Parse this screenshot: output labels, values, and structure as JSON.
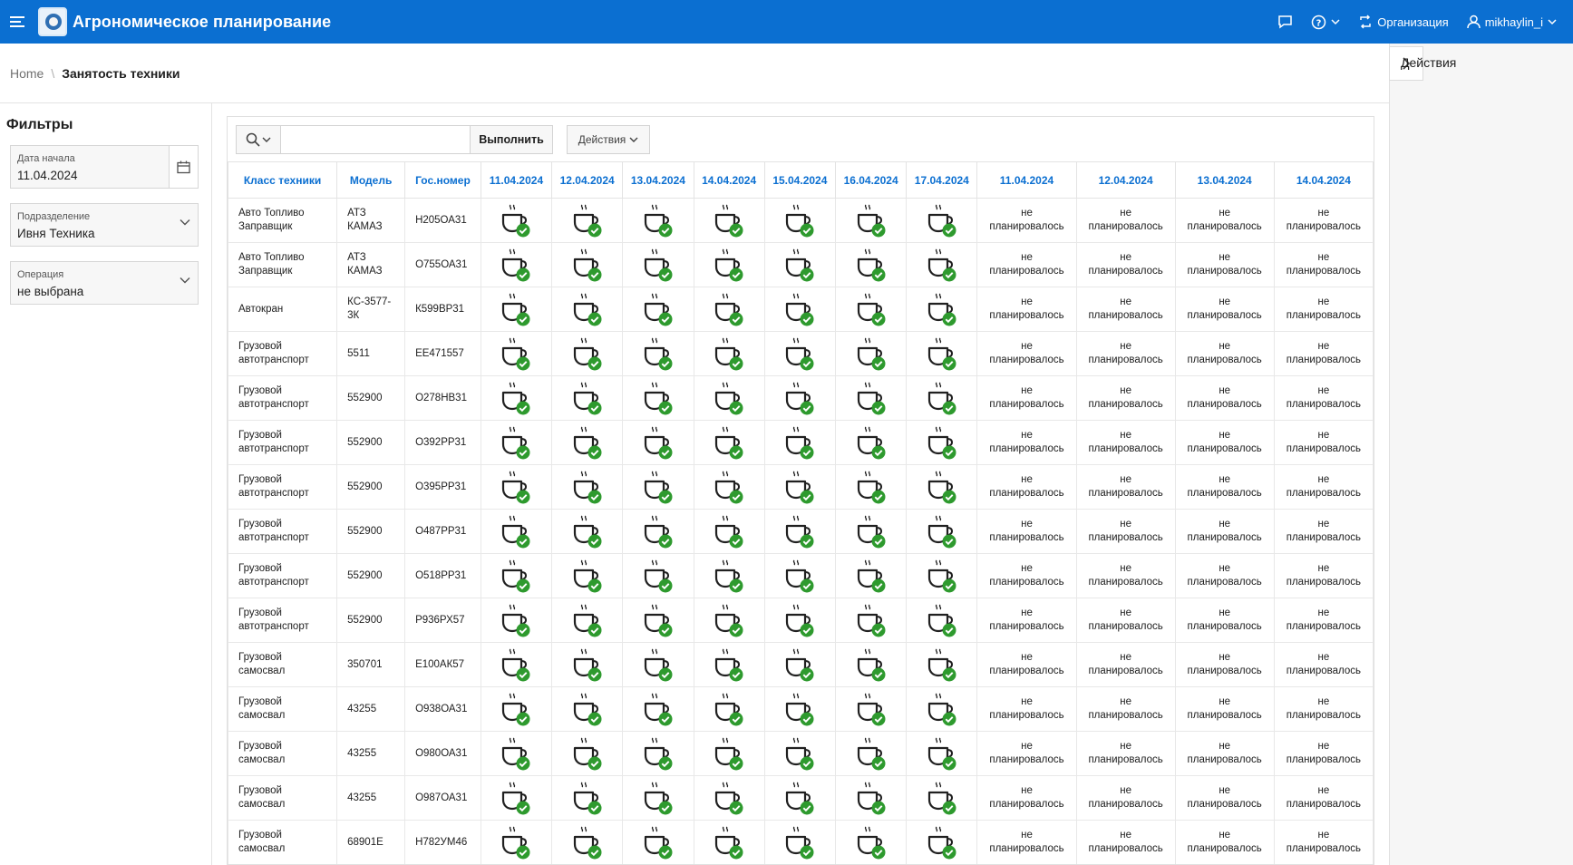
{
  "header": {
    "app_title": "Агрономическое планирование",
    "org_label": "Организация",
    "user_label": "mikhaylin_i"
  },
  "breadcrumb": {
    "home": "Home",
    "current": "Занятость техники"
  },
  "right_panel": {
    "title": "Действия"
  },
  "filters": {
    "title": "Фильтры",
    "start_date": {
      "label": "Дата начала",
      "value": "11.04.2024"
    },
    "division": {
      "label": "Подразделение",
      "value": "Ивня Техника"
    },
    "operation": {
      "label": "Операция",
      "value": "не выбрана"
    }
  },
  "toolbar": {
    "go_label": "Выполнить",
    "actions_label": "Действия",
    "search_value": ""
  },
  "colors": {
    "topbar": "#0b6fd1",
    "header_text": "#0b6fd1",
    "check_green": "#2e9a2e"
  },
  "table": {
    "headers": [
      "Класс техники",
      "Модель",
      "Гос.номер",
      "11.04.2024",
      "12.04.2024",
      "13.04.2024",
      "14.04.2024",
      "15.04.2024",
      "16.04.2024",
      "17.04.2024",
      "11.04.2024",
      "12.04.2024",
      "13.04.2024",
      "14.04.2024"
    ],
    "status_icon": "coffee-cup-check-icon",
    "not_planned": [
      "не",
      "планировалось"
    ],
    "rows": [
      {
        "class": [
          "Авто Топливо",
          "Заправщик"
        ],
        "model": [
          "АТЗ",
          "КАМАЗ"
        ],
        "plate": "Н205ОА31"
      },
      {
        "class": [
          "Авто Топливо",
          "Заправщик"
        ],
        "model": [
          "АТЗ",
          "КАМАЗ"
        ],
        "plate": "О755ОА31"
      },
      {
        "class": [
          "Автокран"
        ],
        "model": [
          "КС-3577-",
          "3К"
        ],
        "plate": "К599ВР31"
      },
      {
        "class": [
          "Грузовой",
          "автотранспорт"
        ],
        "model": [
          "5511"
        ],
        "plate": "ЕЕ471557"
      },
      {
        "class": [
          "Грузовой",
          "автотранспорт"
        ],
        "model": [
          "552900"
        ],
        "plate": "О278НВ31"
      },
      {
        "class": [
          "Грузовой",
          "автотранспорт"
        ],
        "model": [
          "552900"
        ],
        "plate": "О392РР31"
      },
      {
        "class": [
          "Грузовой",
          "автотранспорт"
        ],
        "model": [
          "552900"
        ],
        "plate": "О395РР31"
      },
      {
        "class": [
          "Грузовой",
          "автотранспорт"
        ],
        "model": [
          "552900"
        ],
        "plate": "О487РР31"
      },
      {
        "class": [
          "Грузовой",
          "автотранспорт"
        ],
        "model": [
          "552900"
        ],
        "plate": "О518РР31"
      },
      {
        "class": [
          "Грузовой",
          "автотранспорт"
        ],
        "model": [
          "552900"
        ],
        "plate": "Р936РХ57"
      },
      {
        "class": [
          "Грузовой",
          "самосвал"
        ],
        "model": [
          "350701"
        ],
        "plate": "Е100АК57"
      },
      {
        "class": [
          "Грузовой",
          "самосвал"
        ],
        "model": [
          "43255"
        ],
        "plate": "О938ОА31"
      },
      {
        "class": [
          "Грузовой",
          "самосвал"
        ],
        "model": [
          "43255"
        ],
        "plate": "О980ОА31"
      },
      {
        "class": [
          "Грузовой",
          "самосвал"
        ],
        "model": [
          "43255"
        ],
        "plate": "О987ОА31"
      },
      {
        "class": [
          "Грузовой",
          "самосвал"
        ],
        "model": [
          "68901Е"
        ],
        "plate": "Н782УМ46"
      }
    ]
  }
}
